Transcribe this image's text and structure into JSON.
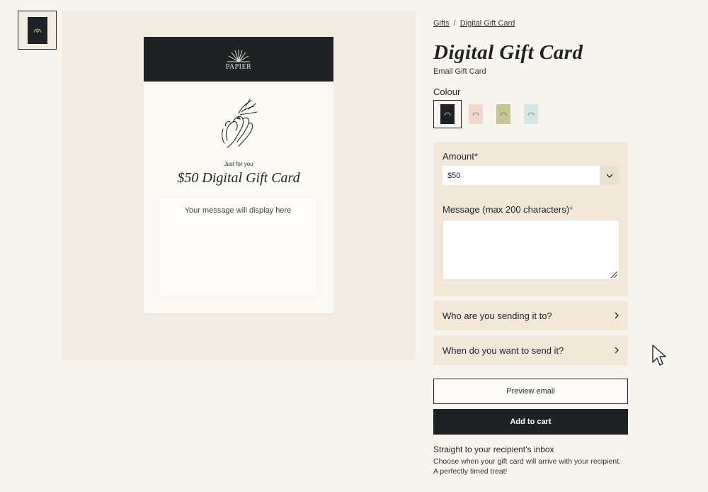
{
  "breadcrumb": {
    "items": [
      "Gifts",
      "Digital Gift Card"
    ],
    "separator": "/"
  },
  "product": {
    "title": "Digital Gift Card",
    "subtitle": "Email Gift Card"
  },
  "preview": {
    "brand": "PAPIER",
    "eyebrow": "Just for you",
    "card_title": "$50 Digital Gift Card",
    "message_placeholder": "Your message will display here"
  },
  "colour": {
    "label": "Colour",
    "options": [
      {
        "name": "black",
        "color": "#1f2224",
        "selected": true
      },
      {
        "name": "pink",
        "color": "#f2d7cd",
        "selected": false
      },
      {
        "name": "olive",
        "color": "#c7c596",
        "selected": false
      },
      {
        "name": "mint",
        "color": "#d6e6e4",
        "selected": false
      }
    ]
  },
  "form": {
    "amount_label": "Amount",
    "amount_value": "$50",
    "message_label": "Message (max 200 characters)",
    "required_mark": "*",
    "message_value": ""
  },
  "accordions": {
    "recipient": "Who are you sending it to?",
    "schedule": "When do you want to send it?"
  },
  "buttons": {
    "preview": "Preview email",
    "add_to_cart": "Add to cart"
  },
  "info": {
    "title": "Straight to your recipient’s inbox",
    "text": "Choose when your gift card will arrive with your recipient. A perfectly timed treat!"
  },
  "colors": {
    "dark": "#1f2224",
    "panel": "#f1e8da",
    "background": "#f8f5ef",
    "required": "#c14b3a"
  },
  "icons": [
    "sunburst-logo-icon",
    "hand-illustration-icon",
    "chevron-down-icon",
    "chevron-right-icon",
    "resize-grip-icon",
    "mouse-cursor-icon"
  ]
}
